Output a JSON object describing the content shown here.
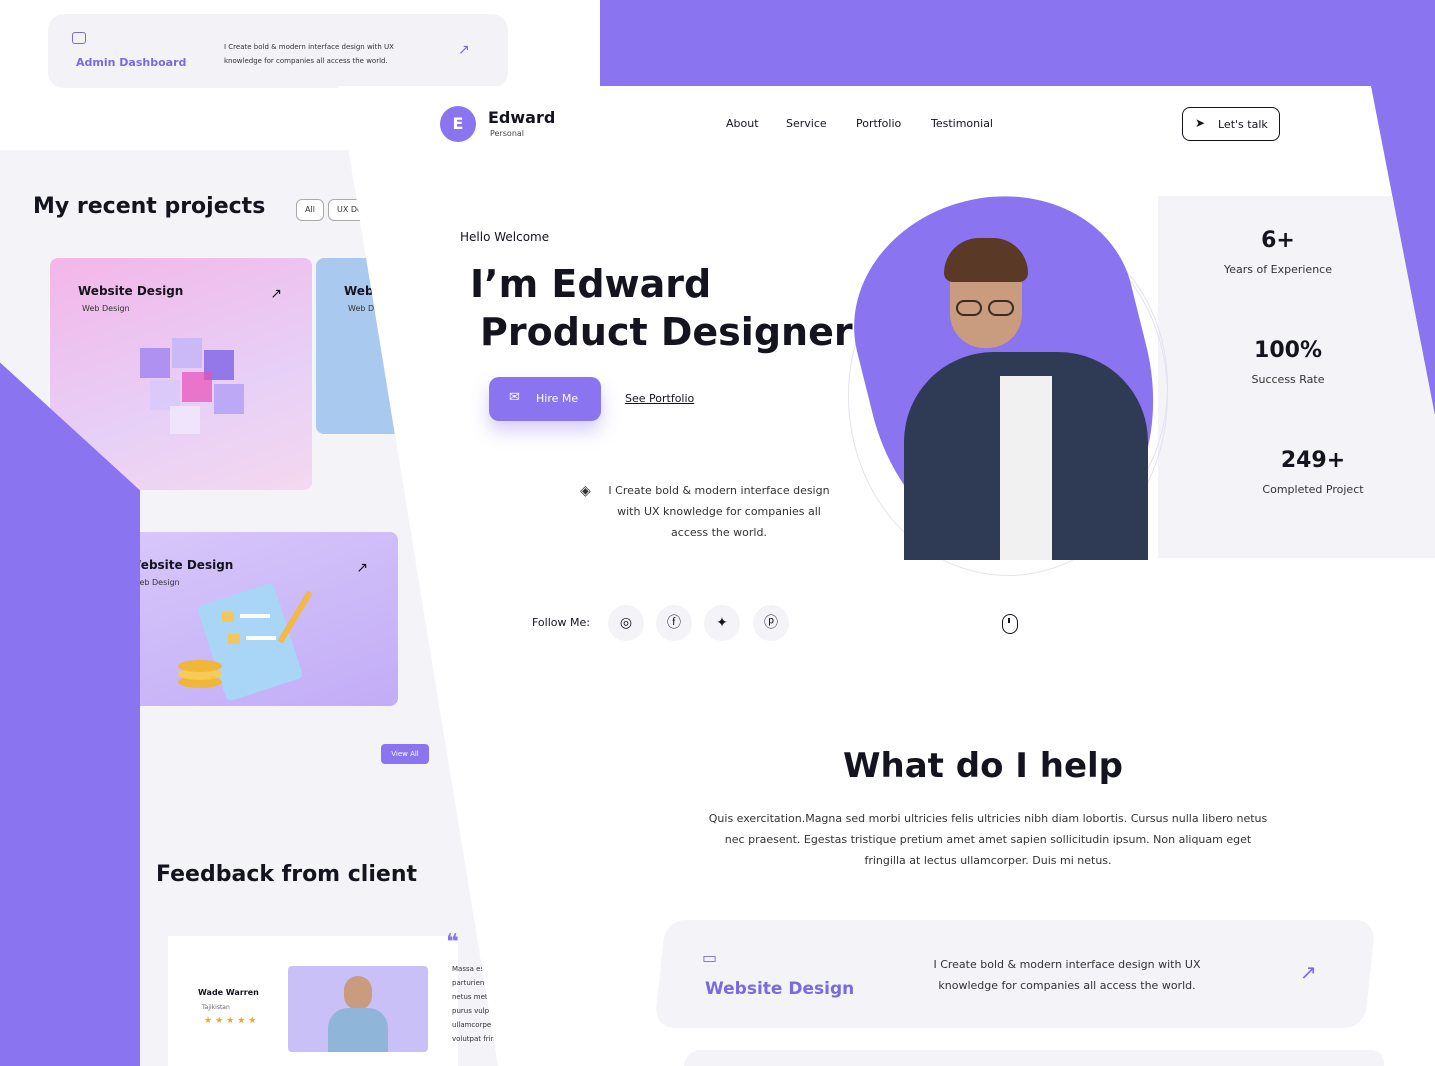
{
  "colors": {
    "accent": "#8a74ef",
    "accent_text": "#7a6ae0",
    "dark": "#14141f",
    "panel": "#f3f3f8"
  },
  "back_page": {
    "admin_card": {
      "title": "Admin Dashboard",
      "desc": "I Create bold & modern interface design with UX knowledge for companies all access the world."
    },
    "recent_title": "My recent projects",
    "filters": [
      "All",
      "UX De"
    ],
    "projects": [
      {
        "title": "Website Design",
        "sub": "Web Design"
      },
      {
        "title": "Websi",
        "sub": "Web Desi"
      },
      {
        "title": "Website Design",
        "sub": "Web Design"
      }
    ],
    "view_all": "View All",
    "feedback_title": "Feedback from client",
    "feedback": {
      "name": "Wade Warren",
      "location": "Tajikistan",
      "stars": "★★★★★",
      "quote_mark": "❝",
      "text_lines": [
        "Massa est nu",
        "parturient nu",
        "netus metus i",
        "purus vulputa",
        "ullamcorper v",
        "volutpat fring"
      ]
    }
  },
  "header": {
    "logo_letter": "E",
    "logo_name": "Edward",
    "logo_sub": "Personal",
    "nav": [
      "About",
      "Service",
      "Portfolio",
      "Testimonial"
    ],
    "cta": "Let's talk"
  },
  "hero": {
    "hello": "Hello Welcome",
    "line1": "I’m Edward",
    "line2": "Product Designer",
    "hire": "Hire Me",
    "see_portfolio": "See Portfolio",
    "desc": "I Create bold & modern interface design with UX knowledge for companies all access the world."
  },
  "stats": [
    {
      "num": "6+",
      "label": "Years of Experience"
    },
    {
      "num": "100%",
      "label": "Success Rate"
    },
    {
      "num": "249+",
      "label": "Completed Project"
    }
  ],
  "follow": {
    "label": "Follow Me:",
    "icons": [
      "instagram-icon",
      "facebook-icon",
      "twitter-icon",
      "pinterest-icon"
    ]
  },
  "help": {
    "title": "What do I help",
    "desc": "Quis exercitation.Magna sed morbi ultricies felis ultricies nibh diam lobortis. Cursus nulla libero netus nec praesent. Egestas tristique pretium amet amet sapien sollicitudin ipsum. Non aliquam eget fringilla at lectus ullamcorper. Duis mi netus."
  },
  "service": {
    "title": "Website Design",
    "desc": "I Create bold & modern interface design with UX knowledge for companies all access the world."
  }
}
